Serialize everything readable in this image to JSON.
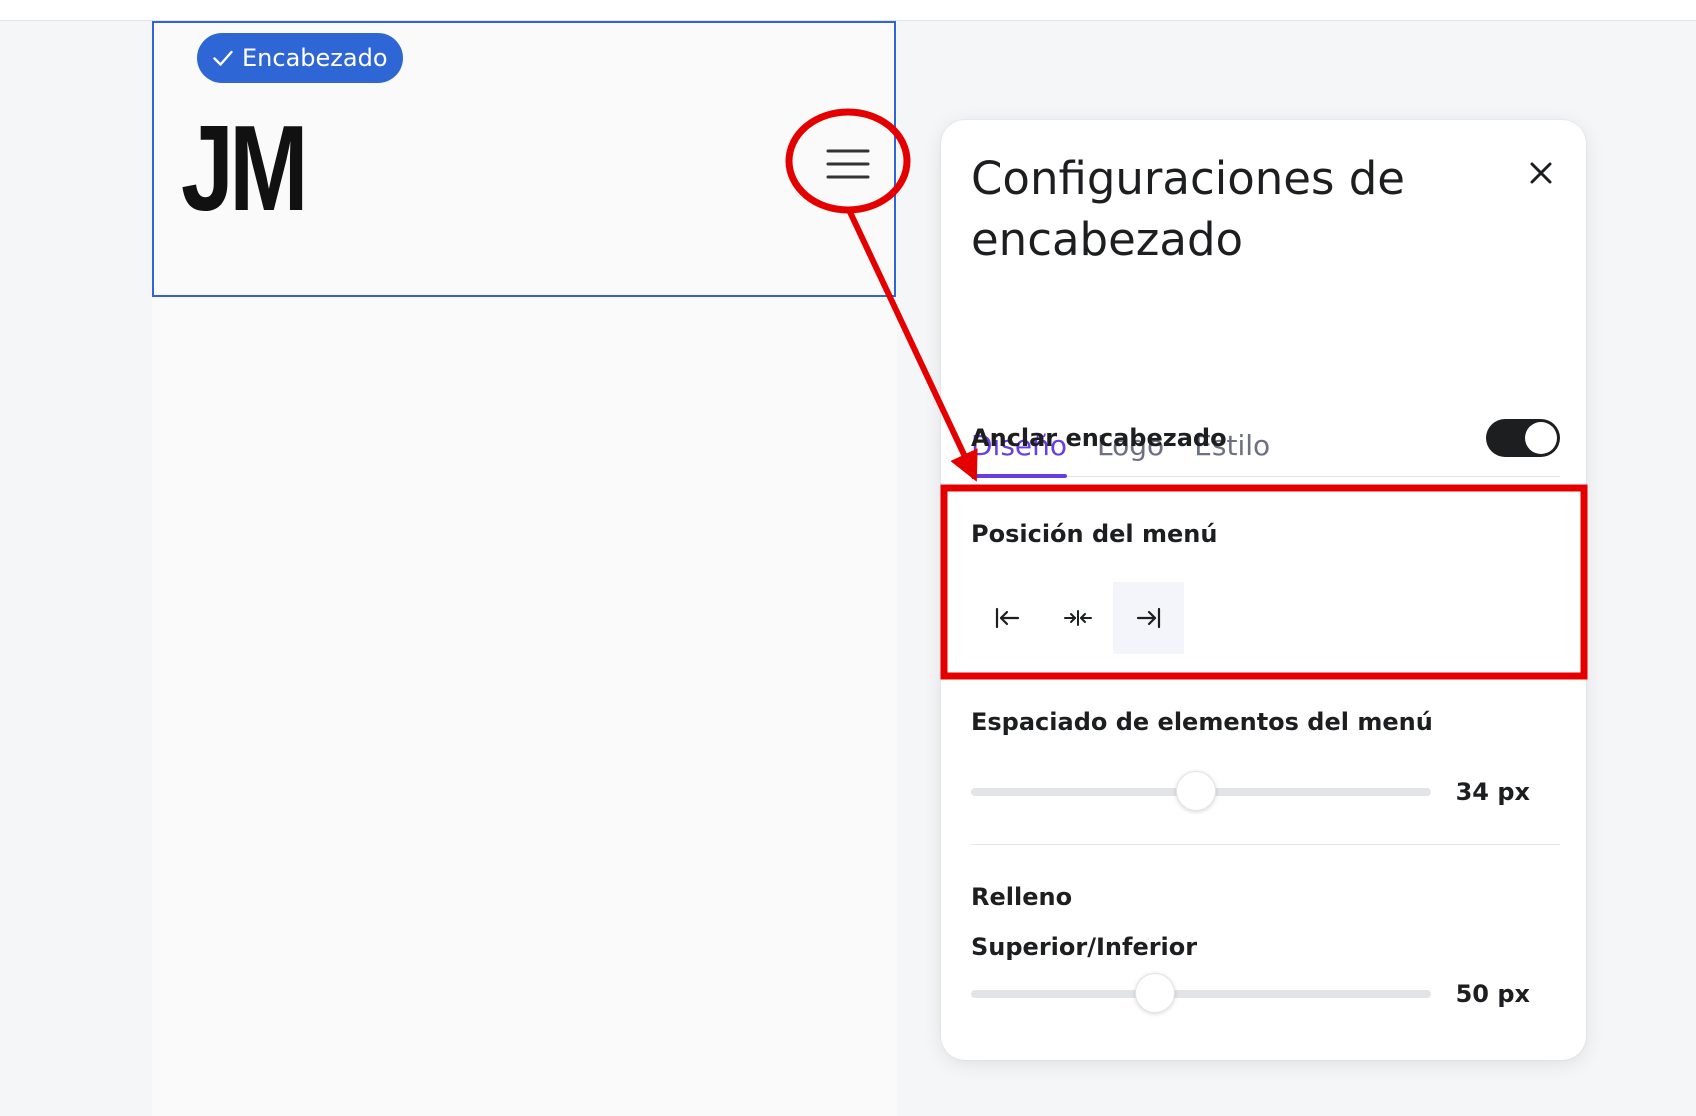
{
  "canvas": {
    "badge_label": "Encabezado",
    "logo_text": "JM"
  },
  "panel": {
    "title": "Configuraciones de encabezado",
    "tabs": [
      {
        "label": "Diseño",
        "active": true
      },
      {
        "label": "Logo",
        "active": false
      },
      {
        "label": "Estilo",
        "active": false
      }
    ],
    "sticky_header": {
      "label": "Anclar encabezado",
      "enabled": true
    },
    "menu_position": {
      "label": "Posición del menú",
      "options": [
        "left",
        "center",
        "right"
      ],
      "selected": "right"
    },
    "menu_item_spacing": {
      "label": "Espaciado de elementos del menú",
      "value_text": "34 px",
      "fraction": 0.49
    },
    "padding": {
      "label": "Relleno",
      "sublabel": "Superior/Inferior",
      "value_text": "50 px",
      "fraction": 0.4
    }
  },
  "colors": {
    "accent": "#673de6",
    "selection": "#2f66d6",
    "annotation": "#e50000"
  }
}
